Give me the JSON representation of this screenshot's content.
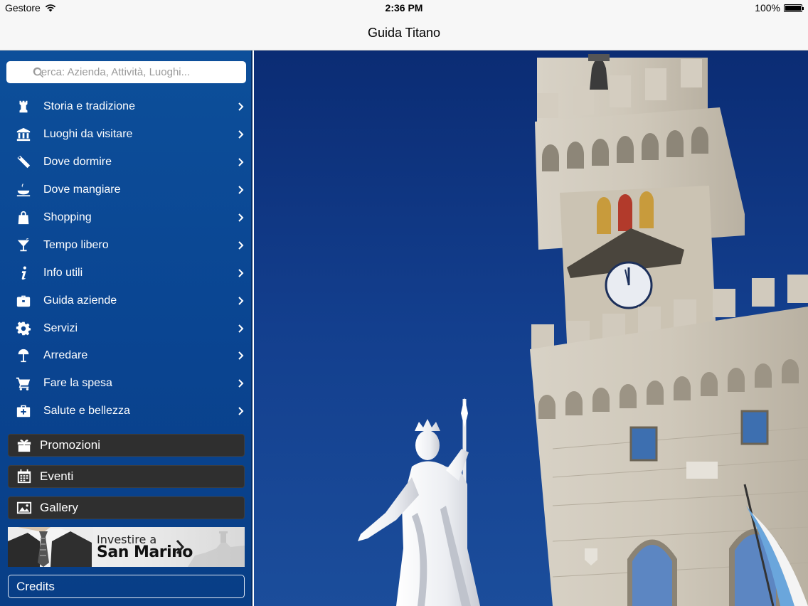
{
  "status_bar": {
    "carrier": "Gestore",
    "time": "2:36 PM",
    "battery": "100%",
    "battery_level": 1.0
  },
  "nav": {
    "title": "Guida Titano"
  },
  "search": {
    "placeholder": "Cerca: Azienda, Attività, Luoghi..."
  },
  "menu": [
    {
      "label": "Storia e tradizione",
      "icon": "rook-icon"
    },
    {
      "label": "Luoghi da visitare",
      "icon": "museum-icon"
    },
    {
      "label": "Dove dormire",
      "icon": "key-tag-icon"
    },
    {
      "label": "Dove mangiare",
      "icon": "food-icon"
    },
    {
      "label": "Shopping",
      "icon": "shopping-bag-icon"
    },
    {
      "label": "Tempo libero",
      "icon": "cocktail-icon"
    },
    {
      "label": "Info utili",
      "icon": "info-icon"
    },
    {
      "label": "Guida aziende",
      "icon": "briefcase-icon"
    },
    {
      "label": "Servizi",
      "icon": "gear-icon"
    },
    {
      "label": "Arredare",
      "icon": "lamp-icon"
    },
    {
      "label": "Fare la spesa",
      "icon": "cart-icon"
    },
    {
      "label": "Salute e bellezza",
      "icon": "first-aid-icon"
    }
  ],
  "actions": {
    "promozioni": "Promozioni",
    "eventi": "Eventi",
    "gallery": "Gallery"
  },
  "banner": {
    "line1": "Investire a",
    "line2": "San Marino"
  },
  "credits": "Credits",
  "colors": {
    "sidebar": "#0a4592",
    "dark_button": "#2f2f2f",
    "sky": "#14418f"
  }
}
